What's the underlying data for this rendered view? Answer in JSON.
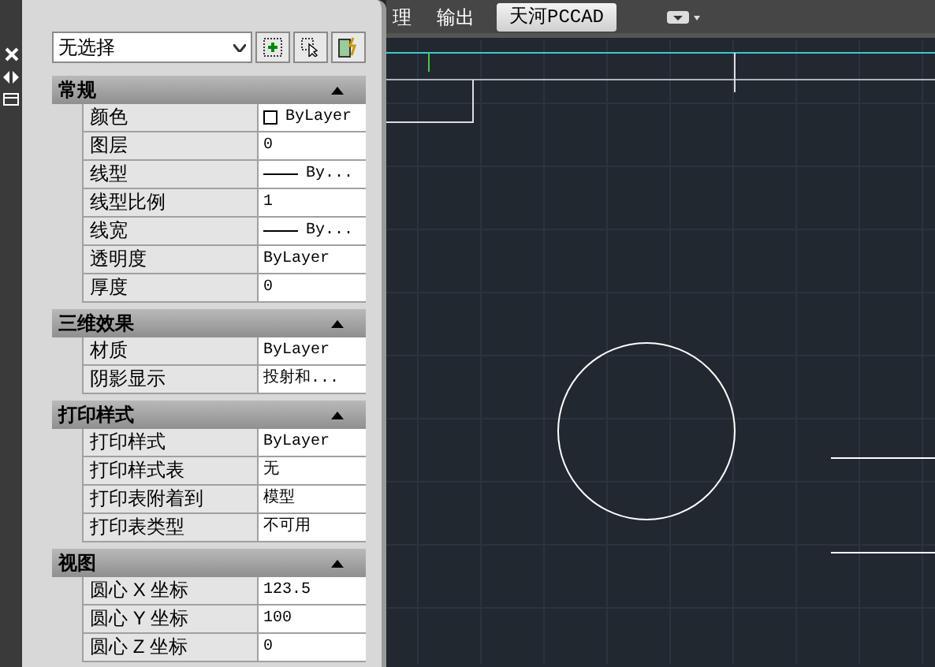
{
  "ribbon_tabs": [
    {
      "label": "理",
      "selected": false
    },
    {
      "label": "输出",
      "selected": false
    },
    {
      "label": "天河PCCAD",
      "selected": true
    }
  ],
  "selection": {
    "value": "无选择"
  },
  "sections": [
    {
      "title": "常规",
      "expanded": true,
      "rows": [
        {
          "label": "颜色",
          "kind": "color",
          "value": "ByLayer"
        },
        {
          "label": "图层",
          "kind": "text",
          "value": "0"
        },
        {
          "label": "线型",
          "kind": "linetype",
          "value": "By..."
        },
        {
          "label": "线型比例",
          "kind": "text",
          "value": "1"
        },
        {
          "label": "线宽",
          "kind": "linetype",
          "value": "By..."
        },
        {
          "label": "透明度",
          "kind": "text",
          "value": "ByLayer"
        },
        {
          "label": "厚度",
          "kind": "text",
          "value": "0"
        }
      ]
    },
    {
      "title": "三维效果",
      "expanded": true,
      "rows": [
        {
          "label": "材质",
          "kind": "text",
          "value": "ByLayer"
        },
        {
          "label": "阴影显示",
          "kind": "text",
          "value": "投射和..."
        }
      ]
    },
    {
      "title": "打印样式",
      "expanded": true,
      "rows": [
        {
          "label": "打印样式",
          "kind": "text",
          "value": "ByLayer"
        },
        {
          "label": "打印样式表",
          "kind": "text",
          "value": "无"
        },
        {
          "label": "打印表附着到",
          "kind": "text",
          "value": "模型"
        },
        {
          "label": "打印表类型",
          "kind": "text",
          "value": "不可用"
        }
      ]
    },
    {
      "title": "视图",
      "expanded": true,
      "rows": [
        {
          "label": "圆心 X 坐标",
          "kind": "text",
          "value": "123.5"
        },
        {
          "label": "圆心 Y 坐标",
          "kind": "text",
          "value": "100"
        },
        {
          "label": "圆心 Z 坐标",
          "kind": "text",
          "value": "0"
        }
      ]
    }
  ]
}
